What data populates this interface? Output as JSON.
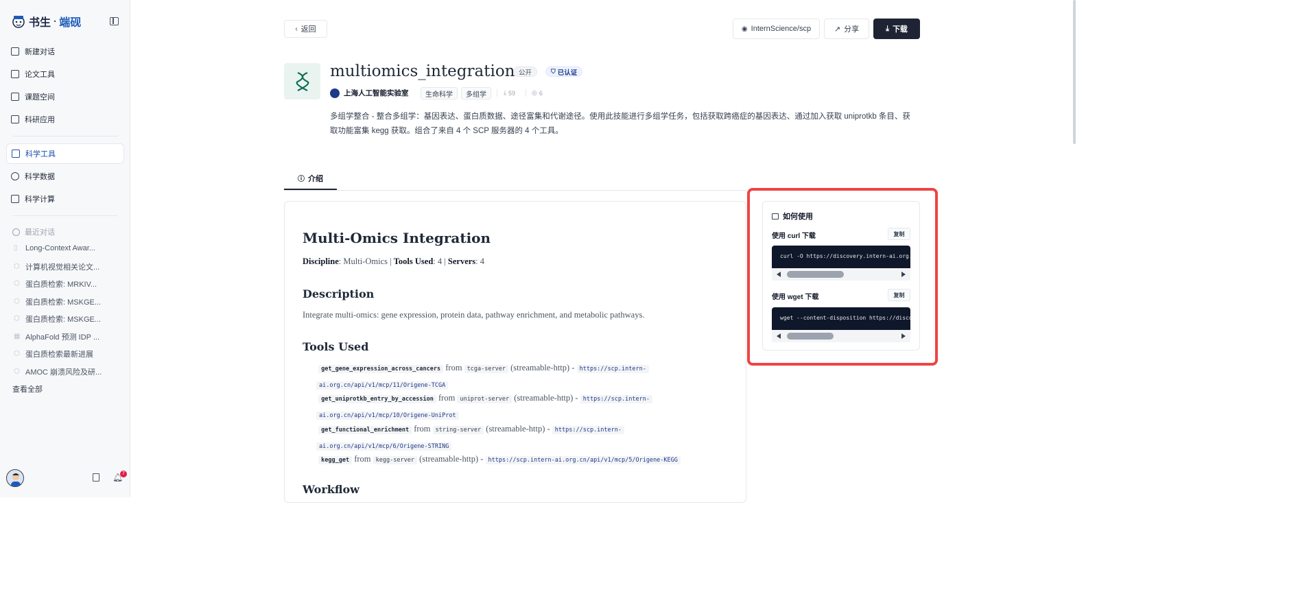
{
  "app": {
    "logo_part1": "书生",
    "logo_dot": "·",
    "logo_part2": "端砚"
  },
  "sidebar": {
    "nav": [
      {
        "label": "新建对话"
      },
      {
        "label": "论文工具"
      },
      {
        "label": "课题空间"
      },
      {
        "label": "科研应用"
      },
      {
        "label": "科学工具"
      },
      {
        "label": "科学数据"
      },
      {
        "label": "科学计算"
      }
    ],
    "recent_header": "最近对话",
    "recent": [
      "Long-Context Awar...",
      "计算机视觉相关论文...",
      "蛋白质检索: MRKIV...",
      "蛋白质检索: MSKGE...",
      "蛋白质检索: MSKGE...",
      "AlphaFold 预测 IDP ...",
      "蛋白质检索最新进展",
      "AMOC 崩溃风险及研..."
    ],
    "see_all": "查看全部",
    "notifications": "7"
  },
  "header": {
    "back": "返回",
    "repo": "InternScience/scp",
    "share": "分享",
    "download": "下载"
  },
  "skill": {
    "title": "multiomics_integration",
    "visibility": "公开",
    "verified": "已认证",
    "org": "上海人工智能实验室",
    "tags": [
      "生命科学",
      "多组学"
    ],
    "downloads": "59",
    "views": "6",
    "description": "多组学整合 - 整合多组学：基因表达、蛋白质数据、途径富集和代谢途径。使用此技能进行多组学任务，包括获取跨癌症的基因表达、通过加入获取 uniprotkb 条目、获取功能富集 kegg 获取。组合了来自 4 个 SCP 服务器的 4 个工具。"
  },
  "tabs": {
    "intro": "介绍"
  },
  "readme": {
    "h1": "Multi-Omics Integration",
    "meta": {
      "k1": "Discipline",
      "v1": ": Multi-Omics | ",
      "k2": "Tools Used",
      "v2": ": 4 | ",
      "k3": "Servers",
      "v3": ": 4"
    },
    "h_desc": "Description",
    "desc": "Integrate multi-omics: gene expression, protein data, pathway enrichment, and metabolic pathways.",
    "h_tools": "Tools Used",
    "from": "from",
    "tools": [
      {
        "fn": "get_gene_expression_across_cancers",
        "server": "tcga-server",
        "proto": "(streamable-http) -",
        "url1": "https://scp.intern-",
        "url2": "ai.org.cn/api/v1/mcp/11/Origene-TCGA"
      },
      {
        "fn": "get_uniprotkb_entry_by_accession",
        "server": "uniprot-server",
        "proto": "(streamable-http) -",
        "url1": "https://scp.intern-",
        "url2": "ai.org.cn/api/v1/mcp/10/Origene-UniProt"
      },
      {
        "fn": "get_functional_enrichment",
        "server": "string-server",
        "proto": "(streamable-http) -",
        "url1": "https://scp.intern-",
        "url2": "ai.org.cn/api/v1/mcp/6/Origene-STRING"
      },
      {
        "fn": "kegg_get",
        "server": "kegg-server",
        "proto": "(streamable-http) -",
        "url1": "https://scp.intern-ai.org.cn/api/v1/mcp/5/Origene-KEGG",
        "url2": ""
      }
    ],
    "h_workflow": "Workflow"
  },
  "howto": {
    "title": "如何使用",
    "curl_label": "使用 curl 下载",
    "wget_label": "使用 wget 下载",
    "copy": "复制",
    "curl_cmd": "curl -O https://discovery.intern-ai.org.cn/d",
    "wget_cmd": "wget --content-disposition https://discovery"
  }
}
